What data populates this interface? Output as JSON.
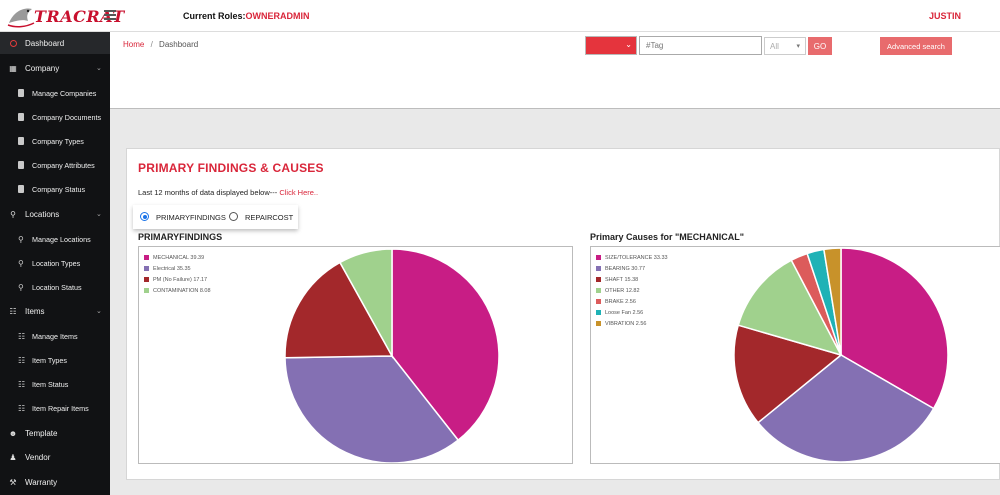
{
  "header": {
    "logo_text": "TRACRAT",
    "roles_label": "Current Roles:",
    "roles_value": "OWNERADMIN",
    "user": "JUSTIN"
  },
  "sidebar": {
    "items": [
      {
        "label": "Dashboard",
        "icon": "dashboard-icon",
        "level": 0,
        "active": true
      },
      {
        "label": "Company",
        "icon": "building-icon",
        "level": 0,
        "expandable": true
      },
      {
        "label": "Manage Companies",
        "icon": "document-icon",
        "level": 1
      },
      {
        "label": "Company Documents",
        "icon": "document-icon",
        "level": 1
      },
      {
        "label": "Company Types",
        "icon": "document-icon",
        "level": 1
      },
      {
        "label": "Company Attributes",
        "icon": "document-icon",
        "level": 1
      },
      {
        "label": "Company Status",
        "icon": "document-icon",
        "level": 1
      },
      {
        "label": "Locations",
        "icon": "map-pin-icon",
        "level": 0,
        "expandable": true
      },
      {
        "label": "Manage Locations",
        "icon": "map-pin-icon",
        "level": 1
      },
      {
        "label": "Location Types",
        "icon": "map-pin-icon",
        "level": 1
      },
      {
        "label": "Location Status",
        "icon": "map-pin-icon",
        "level": 1
      },
      {
        "label": "Items",
        "icon": "sitemap-icon",
        "level": 0,
        "expandable": true
      },
      {
        "label": "Manage Items",
        "icon": "sitemap-icon",
        "level": 1
      },
      {
        "label": "Item Types",
        "icon": "sitemap-icon",
        "level": 1
      },
      {
        "label": "Item Status",
        "icon": "sitemap-icon",
        "level": 1
      },
      {
        "label": "Item Repair Items",
        "icon": "sitemap-icon",
        "level": 1
      },
      {
        "label": "Template",
        "icon": "user-circle-icon",
        "level": 0
      },
      {
        "label": "Vendor",
        "icon": "user-icon",
        "level": 0
      },
      {
        "label": "Warranty",
        "icon": "wrench-icon",
        "level": 0
      }
    ]
  },
  "breadcrumb": {
    "home": "Home",
    "separator": "/",
    "current": "Dashboard"
  },
  "search": {
    "tag_placeholder": "#Tag",
    "all_value": "All",
    "go_label": "GO",
    "advanced_label": "Advanced search"
  },
  "card": {
    "title": "PRIMARY FINDINGS & CAUSES",
    "last12_text": "Last 12 months of data displayed below---",
    "click_here": "Click Here..",
    "radio_primary": "PRIMARYFINDINGS",
    "radio_repair": "REPAIRCOST"
  },
  "colors": {
    "accent": "#d9263a",
    "sidebar_bg": "#111214"
  },
  "chart_data": [
    {
      "type": "pie",
      "title": "PRIMARYFINDINGS",
      "legend": "top-left",
      "slices": [
        {
          "label": "MECHANICAL",
          "value": 39.39,
          "legend_text": "MECHANICAL 39.39",
          "color": "#c81d85"
        },
        {
          "label": "Electrical",
          "value": 35.35,
          "legend_text": "Electrical 35.35",
          "color": "#8470b3"
        },
        {
          "label": "PM (No Failure)",
          "value": 17.17,
          "legend_text": "PM (No Failure) 17.17",
          "color": "#a3282b"
        },
        {
          "label": "CONTAMINATION",
          "value": 8.08,
          "legend_text": "CONTAMINATION 8.08",
          "color": "#a0d18d"
        }
      ]
    },
    {
      "type": "pie",
      "title": "Primary Causes for \"MECHANICAL\"",
      "legend": "top-left",
      "slices": [
        {
          "label": "SIZE/TOLERANCE",
          "value": 33.33,
          "legend_text": "SIZE/TOLERANCE 33.33",
          "color": "#c81d85"
        },
        {
          "label": "BEARING",
          "value": 30.77,
          "legend_text": "BEARING 30.77",
          "color": "#8470b3"
        },
        {
          "label": "SHAFT",
          "value": 15.38,
          "legend_text": "SHAFT 15.38",
          "color": "#a3282b"
        },
        {
          "label": "OTHER",
          "value": 12.82,
          "legend_text": "OTHER 12.82",
          "color": "#a0d18d"
        },
        {
          "label": "BRAKE",
          "value": 2.56,
          "legend_text": "BRAKE 2.56",
          "color": "#dc5b5b"
        },
        {
          "label": "Loose Fan",
          "value": 2.56,
          "legend_text": "Loose Fan 2.56",
          "color": "#1fb2b6"
        },
        {
          "label": "VIBRATION",
          "value": 2.56,
          "legend_text": "VIBRATION 2.56",
          "color": "#c8922a"
        }
      ]
    }
  ]
}
